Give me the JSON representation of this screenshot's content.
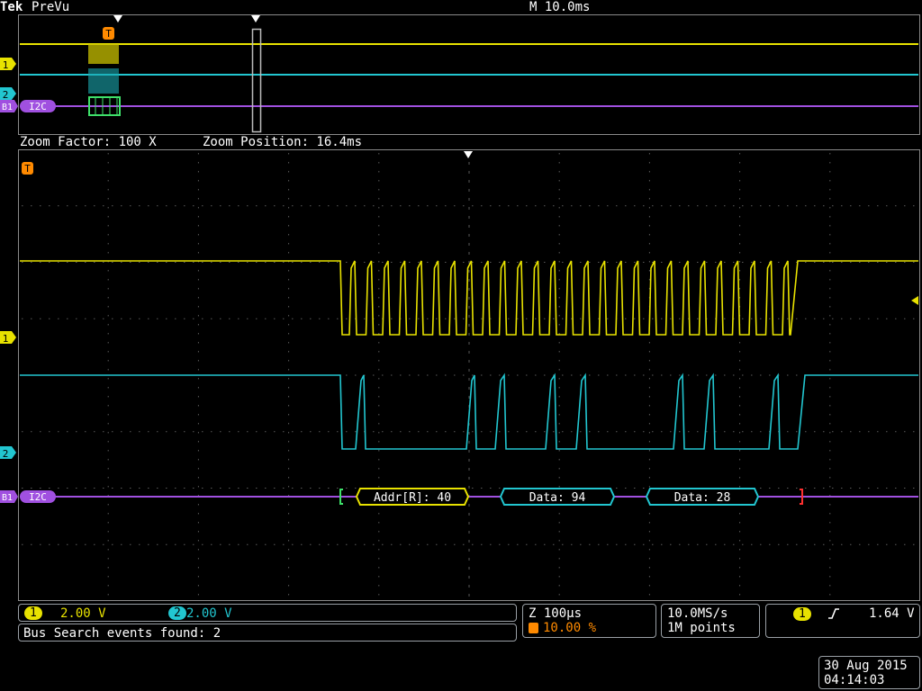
{
  "header": {
    "brand": "Tek",
    "mode": "PreVu",
    "timebase": "M 10.0ms"
  },
  "zoom": {
    "factor_label": "Zoom Factor: 100 X",
    "position_label": "Zoom Position: 16.4ms"
  },
  "channels": {
    "ch1": {
      "marker": "1",
      "color": "#e8e200",
      "scale": "2.00 V"
    },
    "ch2": {
      "marker": "2",
      "color": "#22c6d0",
      "scale": "2.00 V"
    },
    "bus": {
      "marker": "B1",
      "label": "I2C",
      "color": "#a050e0"
    }
  },
  "trigger": {
    "marker": "T",
    "marker_color": "#ff8a00"
  },
  "decode": {
    "packets": [
      {
        "label": "Addr[R]: 40",
        "color": "#e8e200"
      },
      {
        "label": "Data: 94",
        "color": "#22c6d0"
      },
      {
        "label": "Data: 28",
        "color": "#22c6d0"
      }
    ]
  },
  "status": {
    "bus_search": "Bus Search events found: 2",
    "horizontal_scale": "Z 100µs",
    "trigger_position": "10.00 %",
    "sample_rate": "10.0MS/s",
    "record_length": "1M points",
    "trigger_channel": "1",
    "trigger_slope_icon": "rising-edge-icon",
    "trigger_level": "1.64 V",
    "date": "30 Aug 2015",
    "time": "04:14:03"
  }
}
